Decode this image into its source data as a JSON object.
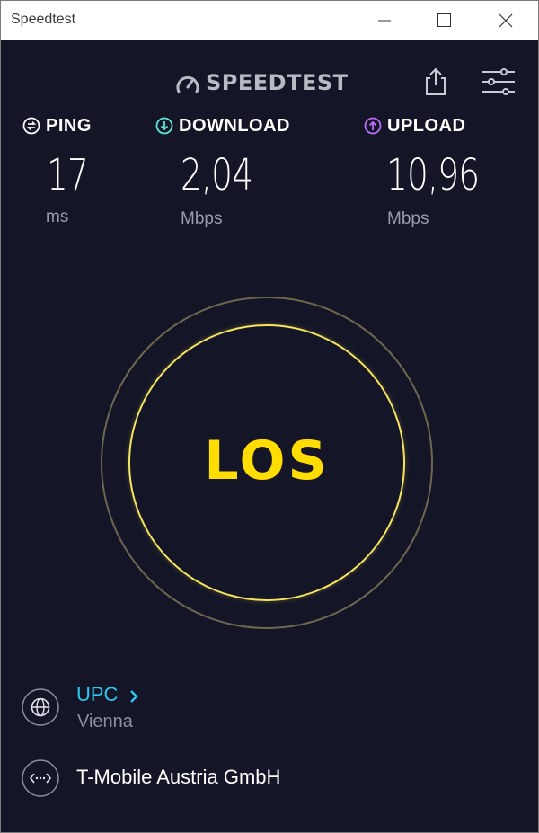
{
  "window": {
    "title": "Speedtest"
  },
  "header": {
    "logo_text": "SPEEDTEST"
  },
  "metrics": {
    "ping": {
      "label": "PING",
      "value": "17",
      "unit": "ms",
      "icon": "ping-icon",
      "color": "#ffffff"
    },
    "download": {
      "label": "DOWNLOAD",
      "value": "2,04",
      "unit": "Mbps",
      "icon": "download-arrow-icon",
      "color": "#5ee8e0"
    },
    "upload": {
      "label": "UPLOAD",
      "value": "10,96",
      "unit": "Mbps",
      "icon": "upload-arrow-icon",
      "color": "#c06eff"
    }
  },
  "go_button": {
    "label": "LOS",
    "color": "#ffdd00"
  },
  "server": {
    "name": "UPC",
    "location": "Vienna",
    "icon": "globe-icon"
  },
  "isp": {
    "name": "T-Mobile Austria GmbH",
    "icon": "connection-icon"
  },
  "colors": {
    "background": "#141526",
    "accent": "#2cc7f0",
    "ring": "#f5e55f"
  }
}
